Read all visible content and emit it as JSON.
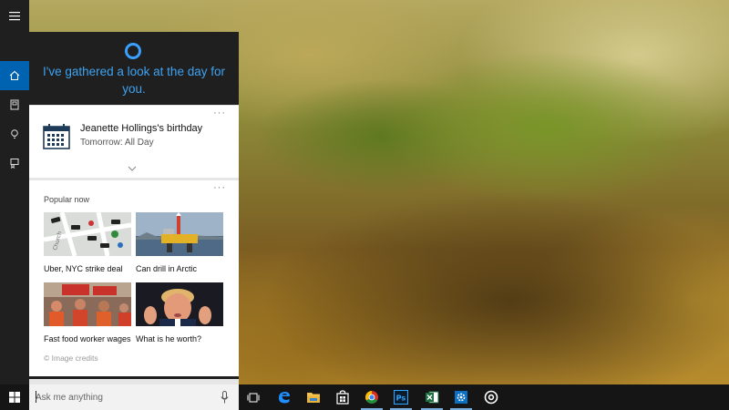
{
  "cortana": {
    "greeting": "I've gathered a look at the day for you.",
    "birthday_card": {
      "title": "Jeanette Hollings's birthday",
      "subtitle": "Tomorrow: All Day",
      "more": "···"
    },
    "popular": {
      "heading": "Popular now",
      "more": "···",
      "items": [
        {
          "caption": "Uber, NYC strike deal"
        },
        {
          "caption": "Can drill in Arctic"
        },
        {
          "caption": "Fast food worker wages"
        },
        {
          "caption": "What is he worth?"
        }
      ],
      "credits": "© Image credits"
    }
  },
  "rail": {
    "items": [
      {
        "icon": "hamburger-menu-icon"
      },
      {
        "icon": "home-icon",
        "active": true
      },
      {
        "icon": "notebook-icon"
      },
      {
        "icon": "lightbulb-icon"
      },
      {
        "icon": "feedback-icon"
      }
    ]
  },
  "taskbar": {
    "search_placeholder": "Ask me anything",
    "apps": [
      {
        "name": "task-view"
      },
      {
        "name": "edge"
      },
      {
        "name": "file-explorer"
      },
      {
        "name": "store"
      },
      {
        "name": "chrome"
      },
      {
        "name": "photoshop",
        "label": "Ps"
      },
      {
        "name": "excel"
      },
      {
        "name": "settings"
      },
      {
        "name": "groove"
      }
    ]
  },
  "colors": {
    "accent": "#0063b1",
    "cortana_blue": "#3ea3f2",
    "panel_dark": "#1f1f1f"
  }
}
